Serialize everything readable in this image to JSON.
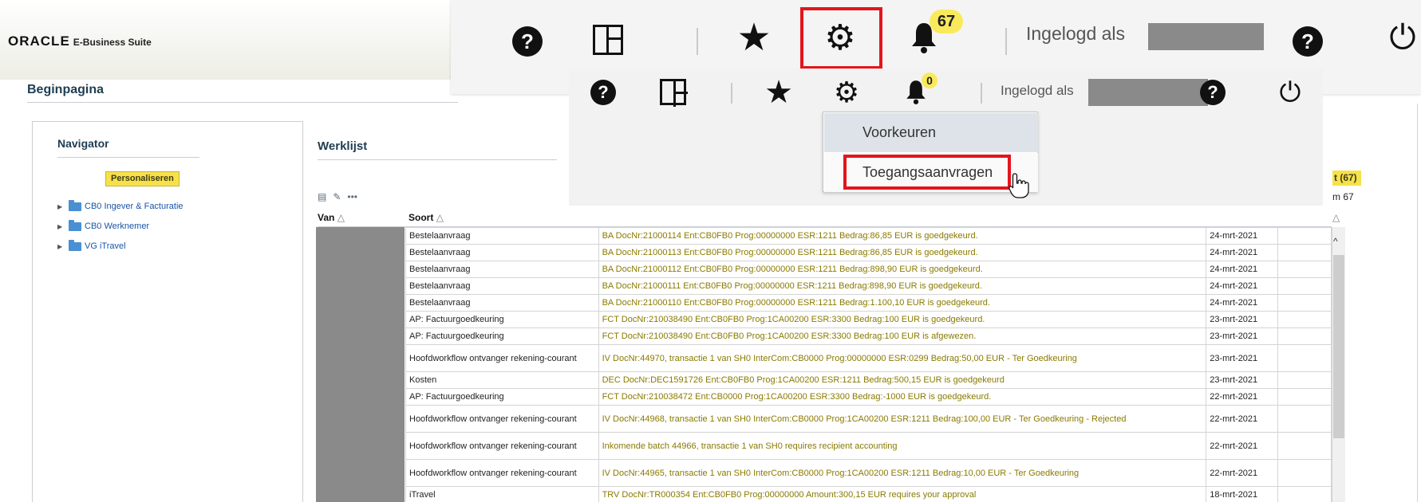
{
  "oracle": {
    "logo_text": "ORACLE",
    "suite_text": "E-Business Suite",
    "page_title": "Beginpagina",
    "navigator": {
      "title": "Navigator",
      "personalize_label": "Personaliseren",
      "items": [
        {
          "label": "CB0 Ingever & Facturatie"
        },
        {
          "label": "CB0 Werknemer"
        },
        {
          "label": "VG iTravel"
        }
      ]
    },
    "worklist": {
      "title": "Werklijst",
      "columns": {
        "van": "Van",
        "soort": "Soort"
      },
      "badge_partial": "t (67)",
      "count_partial": "m 67",
      "rows": [
        {
          "soort": "Bestelaanvraag",
          "subject": "BA DocNr:21000114 Ent:CB0FB0 Prog:00000000 ESR:1211 Bedrag:86,85 EUR is goedgekeurd.",
          "date": "24-mrt-2021",
          "tall": false
        },
        {
          "soort": "Bestelaanvraag",
          "subject": "BA DocNr:21000113 Ent:CB0FB0 Prog:00000000 ESR:1211 Bedrag:86,85 EUR is goedgekeurd.",
          "date": "24-mrt-2021",
          "tall": false
        },
        {
          "soort": "Bestelaanvraag",
          "subject": "BA DocNr:21000112 Ent:CB0FB0 Prog:00000000 ESR:1211 Bedrag:898,90 EUR is goedgekeurd.",
          "date": "24-mrt-2021",
          "tall": false
        },
        {
          "soort": "Bestelaanvraag",
          "subject": "BA DocNr:21000111 Ent:CB0FB0 Prog:00000000 ESR:1211 Bedrag:898,90 EUR is goedgekeurd.",
          "date": "24-mrt-2021",
          "tall": false
        },
        {
          "soort": "Bestelaanvraag",
          "subject": "BA DocNr:21000110 Ent:CB0FB0 Prog:00000000 ESR:1211 Bedrag:1.100,10 EUR is goedgekeurd.",
          "date": "24-mrt-2021",
          "tall": false
        },
        {
          "soort": "AP: Factuurgoedkeuring",
          "subject": "FCT DocNr:210038490 Ent:CB0FB0 Prog:1CA00200 ESR:3300 Bedrag:100 EUR is goedgekeurd.",
          "date": "23-mrt-2021",
          "tall": false
        },
        {
          "soort": "AP: Factuurgoedkeuring",
          "subject": "FCT DocNr:210038490 Ent:CB0FB0 Prog:1CA00200 ESR:3300 Bedrag:100 EUR is afgewezen.",
          "date": "23-mrt-2021",
          "tall": false
        },
        {
          "soort": "Hoofdworkflow ontvanger rekening-courant",
          "subject": "IV DocNr:44970, transactie 1 van SH0 InterCom:CB0000 Prog:00000000 ESR:0299 Bedrag:50,00 EUR - Ter Goedkeuring",
          "date": "23-mrt-2021",
          "tall": true
        },
        {
          "soort": "Kosten",
          "subject": "DEC DocNr:DEC1591726 Ent:CB0FB0 Prog:1CA00200 ESR:1211 Bedrag:500,15 EUR is goedgekeurd",
          "date": "23-mrt-2021",
          "tall": false
        },
        {
          "soort": "AP: Factuurgoedkeuring",
          "subject": "FCT DocNr:210038472 Ent:CB0000 Prog:1CA00200 ESR:3300 Bedrag:-1000 EUR is goedgekeurd.",
          "date": "22-mrt-2021",
          "tall": false
        },
        {
          "soort": "Hoofdworkflow ontvanger rekening-courant",
          "subject": "IV DocNr:44968, transactie 1 van SH0 InterCom:CB0000 Prog:1CA00200 ESR:1211 Bedrag:100,00 EUR - Ter Goedkeuring - Rejected",
          "date": "22-mrt-2021",
          "tall": true
        },
        {
          "soort": "Hoofdworkflow ontvanger rekening-courant",
          "subject": "Inkomende batch 44966, transactie 1 van SH0 requires recipient accounting",
          "date": "22-mrt-2021",
          "tall": true
        },
        {
          "soort": "Hoofdworkflow ontvanger rekening-courant",
          "subject": "IV DocNr:44965, transactie 1 van SH0 InterCom:CB0000 Prog:1CA00200 ESR:1211 Bedrag:10,00 EUR - Ter Goedkeuring",
          "date": "22-mrt-2021",
          "tall": true
        },
        {
          "soort": "iTravel",
          "subject": "TRV DocNr:TR000354 Ent:CB0FB0 Prog:00000000 Amount:300,15 EUR requires your approval",
          "date": "18-mrt-2021",
          "tall": false
        }
      ]
    }
  },
  "big_toolbar": {
    "help_glyph": "?",
    "notification_count": "67",
    "logged_in_label": "Ingelogd als",
    "help2_glyph": "?",
    "power_glyph": "⏻"
  },
  "small_toolbar": {
    "help_glyph": "?",
    "notification_count": "0",
    "logged_in_label": "Ingelogd als",
    "help2_glyph": "?",
    "power_glyph": "⏻"
  },
  "dropdown": {
    "items": [
      {
        "label": "Voorkeuren"
      },
      {
        "label": "Toegangsaanvragen"
      }
    ]
  },
  "colors": {
    "highlight_red": "#e2161c",
    "badge_yellow": "#f9ea5b",
    "subject_olive": "#8a7a00",
    "link_blue": "#1a54a8"
  }
}
